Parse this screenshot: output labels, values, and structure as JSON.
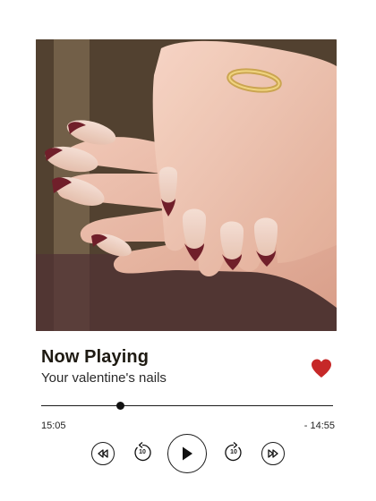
{
  "player": {
    "title": "Now Playing",
    "subtitle": "Your valentine's nails",
    "elapsed": "15:05",
    "remaining": "- 14:55",
    "progress_fraction": 0.27,
    "liked": true
  },
  "controls": {
    "skip_back_seconds": "10",
    "skip_forward_seconds": "10",
    "icons": [
      "rewind-icon",
      "replay-10-icon",
      "play-icon",
      "forward-10-icon",
      "fast-forward-icon"
    ]
  },
  "colors": {
    "heart": "#c62828",
    "text_dark": "#1e1a12",
    "nail_burgundy": "#6b1622",
    "nail_nude": "#e9c7b8"
  }
}
